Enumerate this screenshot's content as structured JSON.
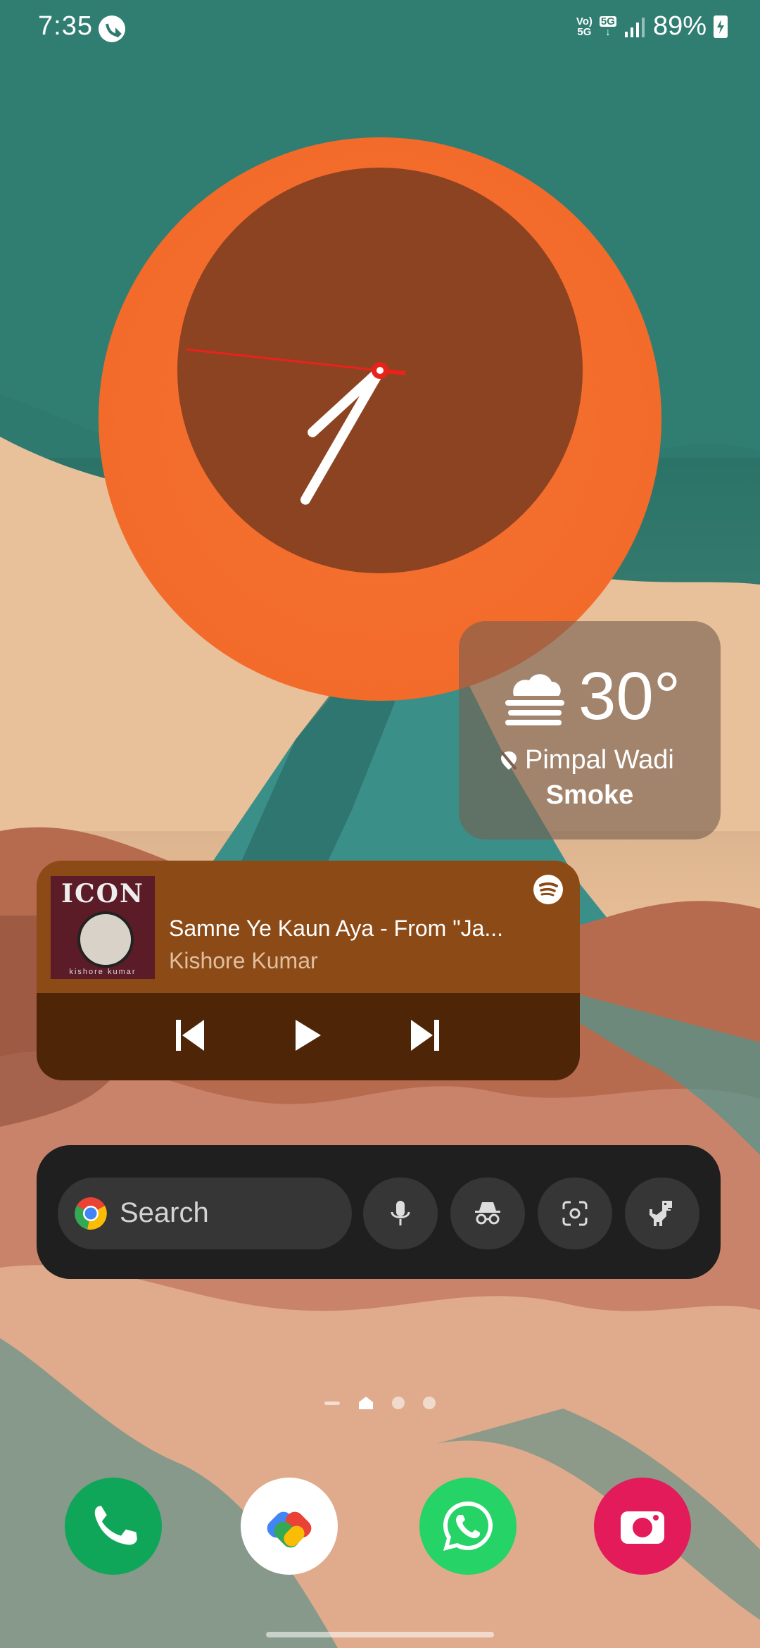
{
  "status_bar": {
    "time": "7:35",
    "volte_label_top": "Vo)",
    "volte_label_bottom": "5G",
    "network_label": "5G",
    "battery": "89%"
  },
  "clock_widget": {
    "hour": 7,
    "minute": 35
  },
  "weather_widget": {
    "temperature": "30°",
    "location": "Pimpal Wadi",
    "condition": "Smoke",
    "icon": "haze-icon"
  },
  "music_widget": {
    "album_text": "ICON",
    "album_artist_text": "kishore kumar",
    "track_title": "Samne Ye Kaun Aya - From \"Ja...",
    "artist": "Kishore Kumar",
    "app_icon": "spotify-icon"
  },
  "search_widget": {
    "placeholder": "Search",
    "buttons": [
      "mic-icon",
      "incognito-icon",
      "lens-icon",
      "dino-icon"
    ]
  },
  "page_indicator": {
    "pages": 3,
    "current": "home"
  },
  "dock": {
    "apps": [
      "Phone",
      "Google Pay",
      "WhatsApp",
      "Camera"
    ]
  },
  "colors": {
    "clock_outer": "#f36b2a",
    "clock_face": "#8c4322",
    "second_hand": "#e8231c",
    "music_top": "#8c4a17",
    "music_bottom": "#4f2508",
    "search_bg": "#1f1f1f"
  }
}
